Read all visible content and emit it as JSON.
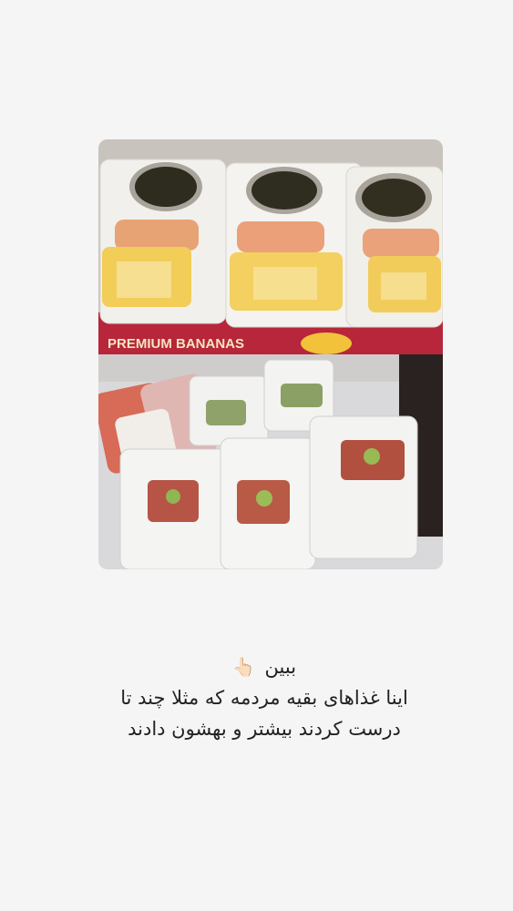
{
  "story": {
    "photo": {
      "top_label": "PREMIUM BANANAS",
      "description": "food-containers-photo"
    },
    "caption": {
      "line1": "ببین",
      "emoji": "👆🏻",
      "line2": "اینا غذاهای بقیه مردمه که مثلا چند تا",
      "line3": "درست کردند بیشتر و بهشون دادند"
    }
  }
}
